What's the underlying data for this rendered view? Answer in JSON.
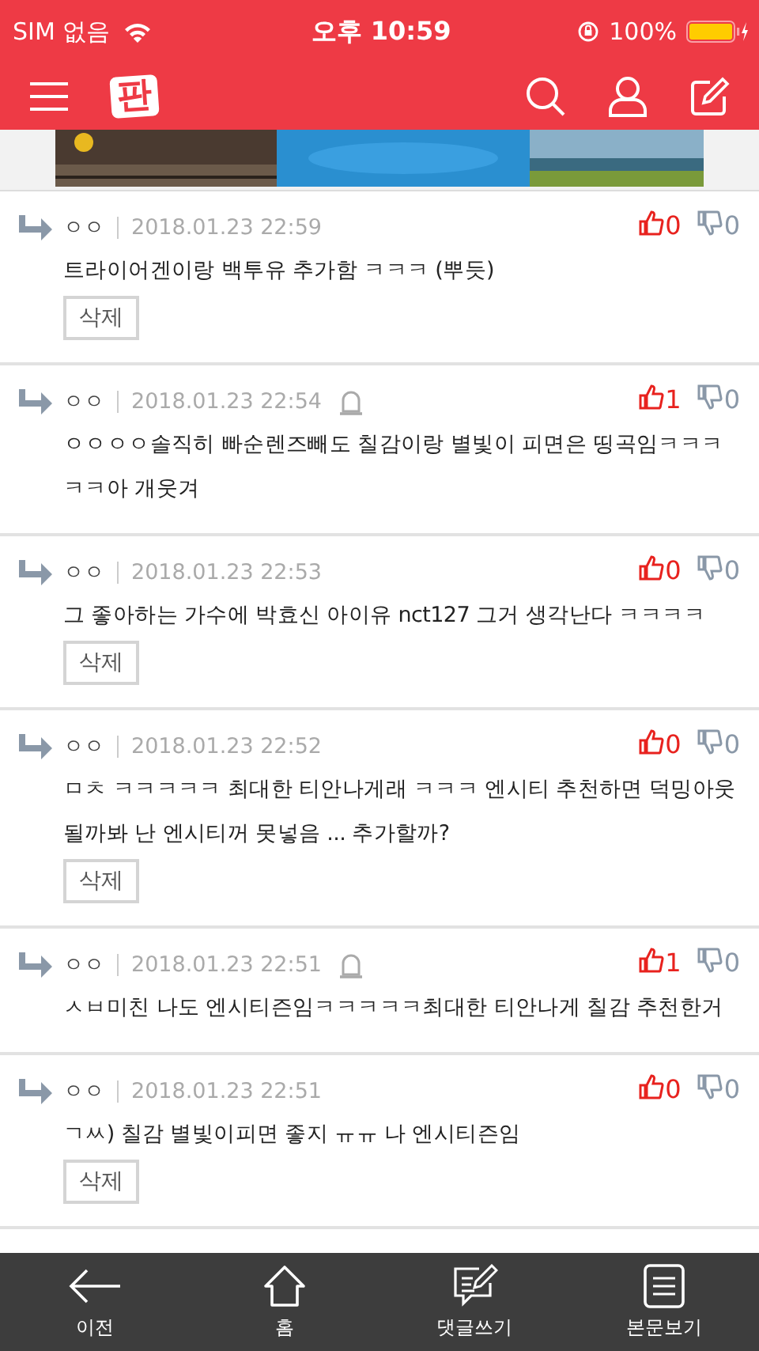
{
  "status_bar": {
    "carrier": "SIM 없음",
    "time": "오후 10:59",
    "battery": "100%"
  },
  "header": {
    "logo": "판"
  },
  "comments": [
    {
      "author": "ㅇㅇ",
      "date": "2018.01.23 22:59",
      "report": false,
      "likes": "0",
      "dislikes": "0",
      "text": "트라이어겐이랑 백투유 추가함 ㅋㅋㅋ (뿌듯)",
      "delete": "삭제"
    },
    {
      "author": "ㅇㅇ",
      "date": "2018.01.23 22:54",
      "report": true,
      "likes": "1",
      "dislikes": "0",
      "text": "ㅇㅇㅇㅇ솔직히 빠순렌즈빼도 칠감이랑 별빛이 피면은 띵곡임ㅋㅋㅋㅋㅋ아 개웃겨"
    },
    {
      "author": "ㅇㅇ",
      "date": "2018.01.23 22:53",
      "report": false,
      "likes": "0",
      "dislikes": "0",
      "text": "그 좋아하는 가수에 박효신 아이유 nct127 그거 생각난다 ㅋㅋㅋㅋ",
      "delete": "삭제"
    },
    {
      "author": "ㅇㅇ",
      "date": "2018.01.23 22:52",
      "report": false,
      "likes": "0",
      "dislikes": "0",
      "text": "ㅁㅊ ㅋㅋㅋㅋㅋ 최대한 티안나게래 ㅋㅋㅋ 엔시티 추천하면 덕밍아웃될까봐 난 엔시티꺼 못넣음 ... 추가할까?",
      "delete": "삭제"
    },
    {
      "author": "ㅇㅇ",
      "date": "2018.01.23 22:51",
      "report": true,
      "likes": "1",
      "dislikes": "0",
      "text": "ㅅㅂ미친 나도 엔시티즌임ㅋㅋㅋㅋㅋ최대한 티안나게 칠감 추천한거"
    },
    {
      "author": "ㅇㅇ",
      "date": "2018.01.23 22:51",
      "report": false,
      "likes": "0",
      "dislikes": "0",
      "text": "ㄱㅆ) 칠감 별빛이피면 좋지 ㅠㅠ 나 엔시티즌임",
      "delete": "삭제"
    }
  ],
  "bottom_nav": [
    {
      "kind": "back",
      "label": "이전"
    },
    {
      "kind": "home",
      "label": "홈"
    },
    {
      "kind": "write",
      "label": "댓글쓰기"
    },
    {
      "kind": "article",
      "label": "본문보기"
    }
  ]
}
